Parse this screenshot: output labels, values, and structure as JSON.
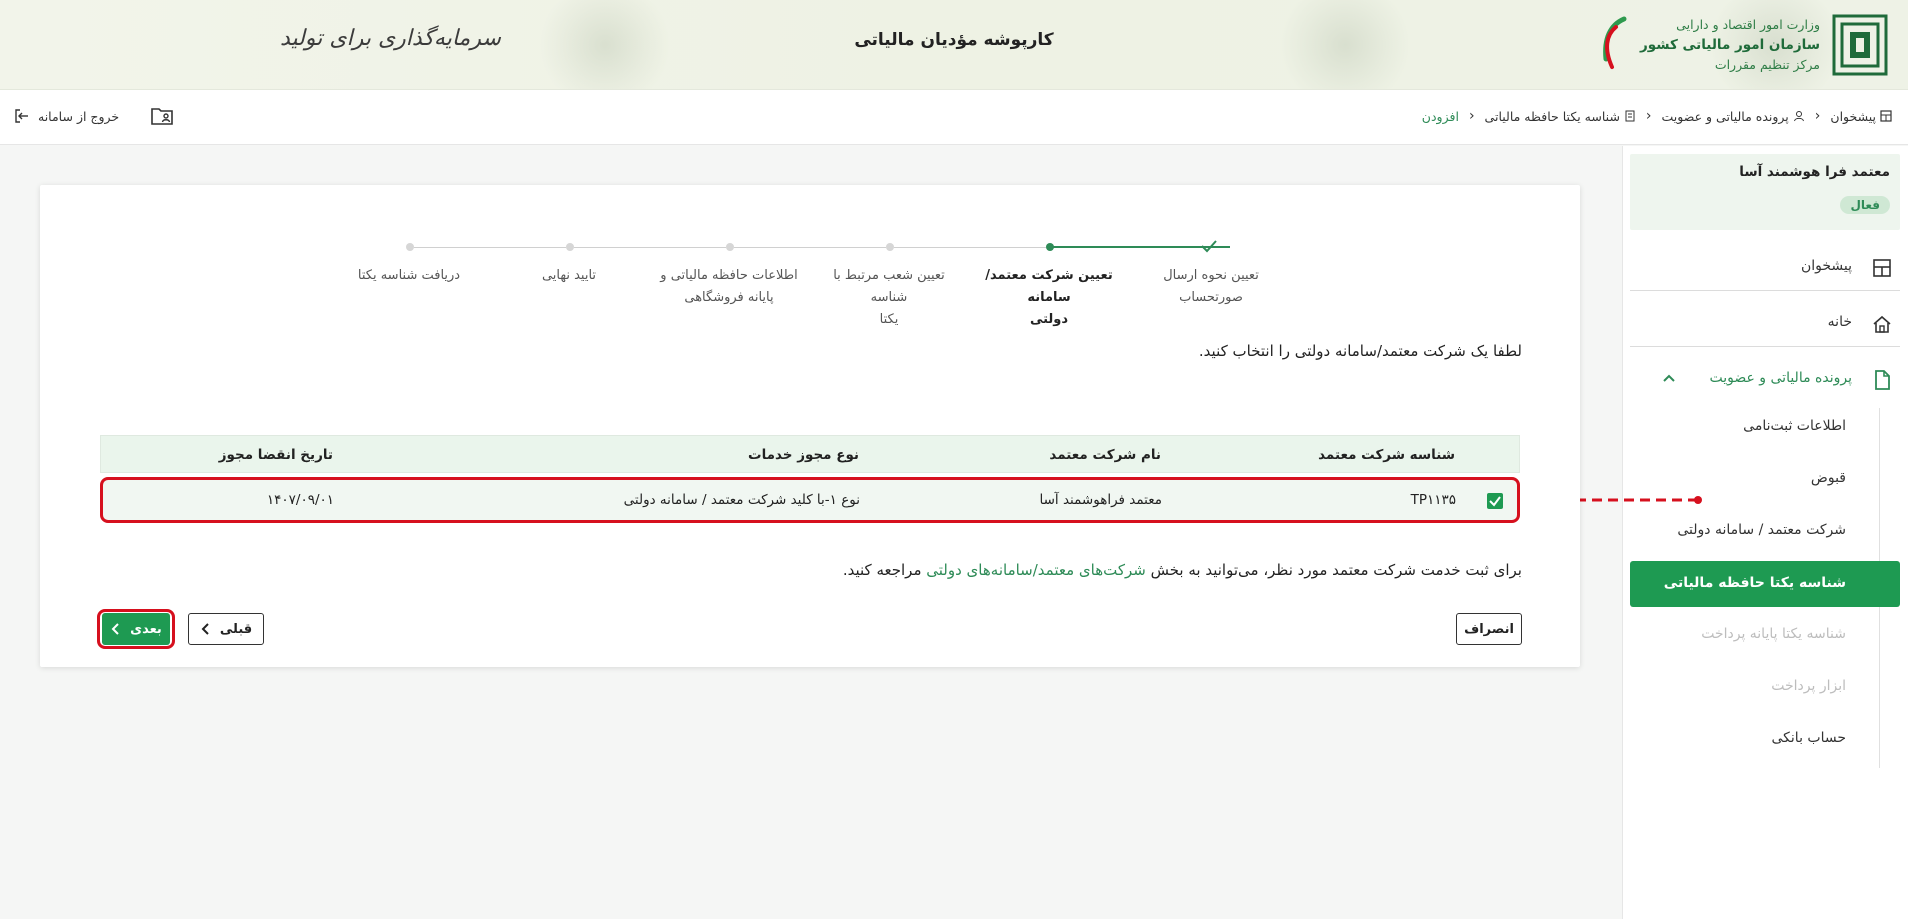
{
  "banner": {
    "title": "کارپوشه مؤدیان مالیاتی",
    "org_line1": "وزارت امور اقتصاد و دارایی",
    "org_line2": "سازمان امور مالیاتی کشور",
    "org_line3": "مرکز تنظیم مقررات",
    "slogan": "سرمایه‌گذاری برای تولید"
  },
  "toolbar": {
    "breadcrumb": [
      "پیشخوان",
      "پرونده مالیاتی و عضویت",
      "شناسه یکتا حافظه مالیاتی",
      "افزودن"
    ],
    "exit_label": "خروج از سامانه"
  },
  "sidebar": {
    "user_name": "معتمد فرا هوشمند آسا",
    "user_status": "فعال",
    "dashboard": "پیشخوان",
    "home": "خانه",
    "section": "پرونده مالیاتی و عضویت",
    "sub_items": [
      "اطلاعات ثبت‌نامی",
      "قبوض",
      "شرکت معتمد / سامانه دولتی"
    ],
    "active_item": "شناسه یکتا حافظه مالیاتی",
    "disabled_items": [
      "شناسه یکتا پایانه پرداخت",
      "ابزار پرداخت"
    ],
    "bank": "حساب بانکی"
  },
  "stepper": {
    "steps": [
      {
        "line1": "تعیین نحوه ارسال",
        "line2": "صورتحساب"
      },
      {
        "line1": "تعیین شرکت معتمد/سامانه",
        "line2": "دولتی"
      },
      {
        "line1": "تعیین شعب مرتبط با شناسه",
        "line2": "یکتا"
      },
      {
        "line1": "اطلاعات حافظه مالیاتی و",
        "line2": "پایانه فروشگاهی"
      },
      {
        "line1": "تایید نهایی",
        "line2": ""
      },
      {
        "line1": "دریافت شناسه یکتا",
        "line2": ""
      }
    ]
  },
  "main": {
    "instruction": "لطفا یک شرکت معتمد/سامانه دولتی را انتخاب کنید.",
    "table": {
      "headers": [
        "شناسه شرکت معتمد",
        "نام شرکت معتمد",
        "نوع مجوز خدمات",
        "تاریخ انقضا مجوز"
      ],
      "row": [
        "TP۱۱۳۵",
        "معتمد فراهوشمند آسا",
        "نوع ۱-با کلید شرکت معتمد / سامانه دولتی",
        "۱۴۰۷/۰۹/۰۱"
      ]
    },
    "note_before": "برای ثبت خدمت شرکت معتمد مورد نظر، می‌توانید به بخش ",
    "note_link": "شرکت‌های معتمد/سامانه‌های دولتی",
    "note_after": " مراجعه کنید.",
    "cancel_label": "انصراف",
    "prev_label": "قبلی",
    "next_label": "بعدی"
  },
  "colors": {
    "brand_green": "#1e9a52",
    "highlight_red": "#d6101e"
  }
}
